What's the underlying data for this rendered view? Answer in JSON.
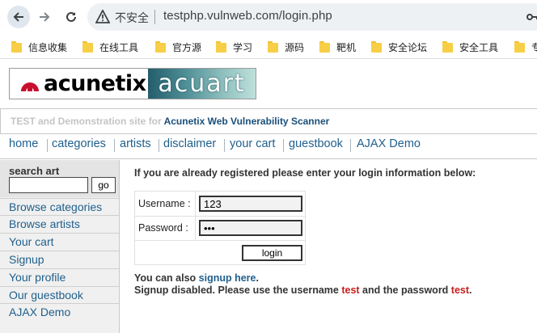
{
  "browser": {
    "insecure_label": "不安全",
    "url": "testphp.vulnweb.com/login.php",
    "bookmarks": [
      {
        "label": "信息收集"
      },
      {
        "label": "在线工具"
      },
      {
        "label": "官方源"
      },
      {
        "label": "学习"
      },
      {
        "label": "源码"
      },
      {
        "label": "靶机"
      },
      {
        "label": "安全论坛"
      },
      {
        "label": "安全工具"
      },
      {
        "label": "专"
      }
    ],
    "icons": {
      "back": "arrow-left-icon",
      "forward": "arrow-right-icon",
      "reload": "reload-icon",
      "warning": "warning-triangle-icon",
      "key": "key-icon",
      "bookmark": "folder-icon"
    }
  },
  "site": {
    "logo_word": "acunetix",
    "logo_product": "acuart",
    "tagline_prefix": "TEST and Demonstration site for ",
    "tagline_product": "Acunetix Web Vulnerability Scanner",
    "nav": [
      {
        "label": "home"
      },
      {
        "label": "categories"
      },
      {
        "label": "artists"
      },
      {
        "label": "disclaimer"
      },
      {
        "label": "your cart"
      },
      {
        "label": "guestbook"
      },
      {
        "label": "AJAX Demo"
      }
    ],
    "sidebar": {
      "search_label": "search art",
      "search_value": "",
      "go_label": "go",
      "items": [
        {
          "label": "Browse categories"
        },
        {
          "label": "Browse artists"
        },
        {
          "label": "Your cart"
        },
        {
          "label": "Signup"
        },
        {
          "label": "Your profile"
        },
        {
          "label": "Our guestbook"
        },
        {
          "label": "AJAX Demo"
        }
      ]
    },
    "login": {
      "intro": "If you are already registered please enter your login information below:",
      "username_label": "Username :",
      "username_value": "123",
      "password_label": "Password :",
      "password_value": "•••",
      "button_label": "login"
    },
    "signup": {
      "prefix": "You can also ",
      "link": "signup here",
      "suffix": ".",
      "disabled_prefix": "Signup disabled. Please use the username ",
      "username": "test",
      "middle": " and the password ",
      "password": "test",
      "end": "."
    }
  },
  "colors": {
    "link": "#1f5f8c",
    "highlight": "#c81e1e",
    "logo_red": "#c8102e"
  }
}
